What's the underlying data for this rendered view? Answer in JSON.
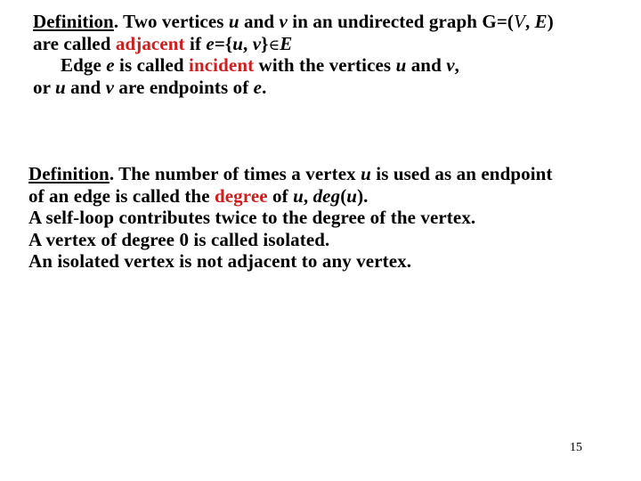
{
  "colors": {
    "text": "#000000",
    "highlight": "#cc1f1f",
    "background": "#ffffff"
  },
  "definition1": {
    "line1": {
      "label": "Definition",
      "after_label": ". Two vertices ",
      "u": "u",
      "and": " and ",
      "v": "v",
      "rest": " in an undirected graph G=(",
      "V": "V",
      "comma": ", ",
      "E": "E",
      "close": ")"
    },
    "line2": {
      "start": "are called ",
      "term": "adjacent",
      "if": " if ",
      "e": "e",
      "eq": "={",
      "u": "u",
      "comma": ", ",
      "v": "v",
      "brace": "}",
      "in": "∈",
      "E": "E"
    },
    "line3": {
      "start": "Edge ",
      "e": "e",
      "mid": " is called ",
      "term": "incident",
      "rest": " with the vertices ",
      "u": "u",
      "and": " and ",
      "v": "v",
      "end": ","
    },
    "line4": {
      "start": "or ",
      "u": "u",
      "and": " and ",
      "v": "v",
      "mid": " are endpoints of ",
      "e": "e",
      "end": "."
    }
  },
  "definition2": {
    "line1": {
      "label": "Definition",
      "after_label": ". The number of times a vertex ",
      "u": "u",
      "rest": " is used as an endpoint"
    },
    "line2": {
      "start": "of an edge is called the ",
      "term": "degree",
      "of": " of ",
      "u": "u",
      "comma": ", ",
      "deg": "deg",
      "open": "(",
      "u2": "u",
      "close": ")."
    },
    "line3": "A self-loop contributes twice to the degree of the vertex.",
    "line4": "A vertex of degree 0 is called isolated.",
    "line5": "An isolated vertex is not adjacent to any vertex."
  },
  "page_number": "15"
}
